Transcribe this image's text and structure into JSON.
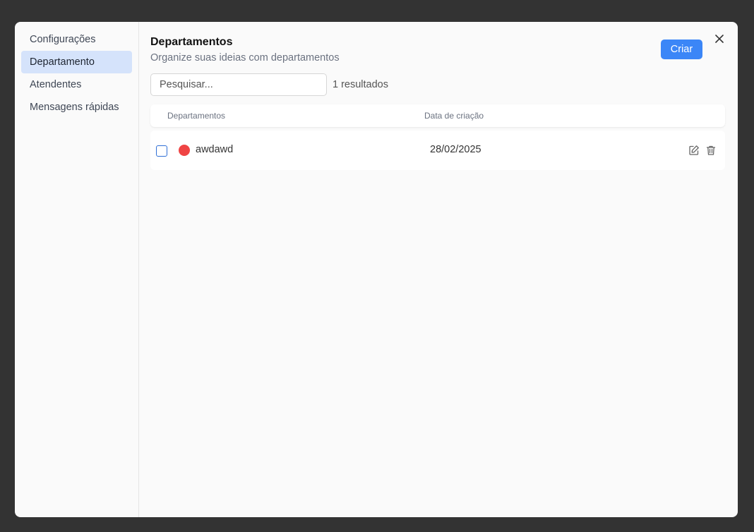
{
  "sidebar": {
    "items": [
      {
        "label": "Configurações",
        "active": false
      },
      {
        "label": "Departamento",
        "active": true
      },
      {
        "label": "Atendentes",
        "active": false
      },
      {
        "label": "Mensagens rápidas",
        "active": false
      }
    ]
  },
  "header": {
    "title": "Departamentos",
    "subtitle": "Organize suas ideias com departamentos",
    "create_label": "Criar",
    "close_icon": "close-icon"
  },
  "search": {
    "placeholder": "Pesquisar...",
    "value": "",
    "results": "1 resultados"
  },
  "table": {
    "columns": [
      "Departamentos",
      "Data de criação"
    ],
    "rows": [
      {
        "name": "awdawd",
        "date": "28/02/2025",
        "color": "#ef4444",
        "checked": false
      }
    ]
  },
  "colors": {
    "accent": "#3b86f7",
    "active_bg": "#d5e3fb"
  }
}
